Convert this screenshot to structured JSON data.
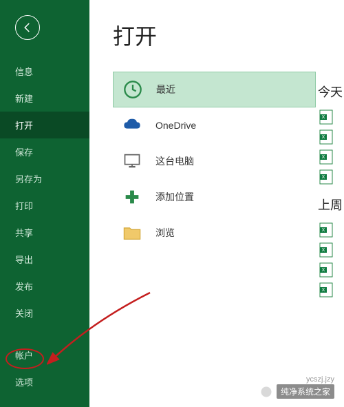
{
  "sidebar": {
    "items": [
      {
        "label": "信息"
      },
      {
        "label": "新建"
      },
      {
        "label": "打开"
      },
      {
        "label": "保存"
      },
      {
        "label": "另存为"
      },
      {
        "label": "打印"
      },
      {
        "label": "共享"
      },
      {
        "label": "导出"
      },
      {
        "label": "发布"
      },
      {
        "label": "关闭"
      }
    ],
    "account_label": "帐户",
    "options_label": "选项"
  },
  "main": {
    "title": "打开",
    "locations": [
      {
        "label": "最近",
        "icon": "clock"
      },
      {
        "label": "OneDrive",
        "icon": "cloud"
      },
      {
        "label": "这台电脑",
        "icon": "computer"
      },
      {
        "label": "添加位置",
        "icon": "plus"
      },
      {
        "label": "浏览",
        "icon": "folder"
      }
    ]
  },
  "right": {
    "section1": "今天",
    "section2": "上周"
  },
  "watermark": {
    "text": "纯净系统之家",
    "url": "ycszj.jzy"
  }
}
